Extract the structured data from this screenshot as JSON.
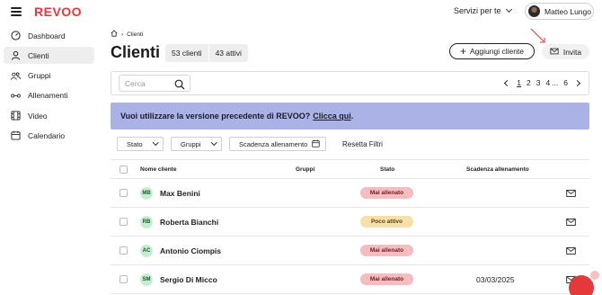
{
  "app": {
    "logo": "REVOO",
    "brand_color": "#e5383b"
  },
  "header": {
    "services_label": "Servizi per te",
    "user_name": "Matteo Lungo"
  },
  "sidebar": {
    "items": [
      {
        "label": "Dashboard",
        "icon": "gauge-icon",
        "active": false
      },
      {
        "label": "Clienti",
        "icon": "user-icon",
        "active": true
      },
      {
        "label": "Gruppi",
        "icon": "group-icon",
        "active": false
      },
      {
        "label": "Allenamenti",
        "icon": "dumbbell-icon",
        "active": false
      },
      {
        "label": "Video",
        "icon": "film-icon",
        "active": false
      },
      {
        "label": "Calendario",
        "icon": "calendar-icon",
        "active": false
      }
    ]
  },
  "breadcrumb": {
    "current": "Clienti"
  },
  "page": {
    "title": "Clienti",
    "count_total": "53 clienti",
    "count_active": "43 attivi",
    "add_button": "Aggiungi cliente",
    "invite_button": "Invita"
  },
  "search": {
    "placeholder": "Cerca",
    "value": ""
  },
  "pagination": {
    "pages": [
      "1",
      "2",
      "3",
      "4",
      "...",
      "6"
    ],
    "current": "1"
  },
  "banner": {
    "text": "Vuoi utilizzare la versione precedente di REVOO?",
    "link": "Clicca qui",
    "suffix": ".",
    "color": "#abb3e6"
  },
  "filters": {
    "state": "Stato",
    "groups": "Gruppi",
    "expiry": "Scadenza allenamento",
    "reset": "Resetta Filtri"
  },
  "table": {
    "headers": {
      "name": "Nome cliente",
      "groups": "Gruppi",
      "state": "Stato",
      "expiry": "Scadenza allenamento"
    },
    "rows": [
      {
        "initials": "MB",
        "name": "Max Benini",
        "status": "Mai allenato",
        "status_color": "red",
        "expiry": ""
      },
      {
        "initials": "RB",
        "name": "Roberta Bianchi",
        "status": "Poco attivo",
        "status_color": "yellow",
        "expiry": ""
      },
      {
        "initials": "AC",
        "name": "Antonio Ciompis",
        "status": "Mai allenato",
        "status_color": "red",
        "expiry": ""
      },
      {
        "initials": "SM",
        "name": "Sergio Di Micco",
        "status": "Mai allenato",
        "status_color": "red",
        "expiry": "03/03/2025"
      }
    ]
  }
}
